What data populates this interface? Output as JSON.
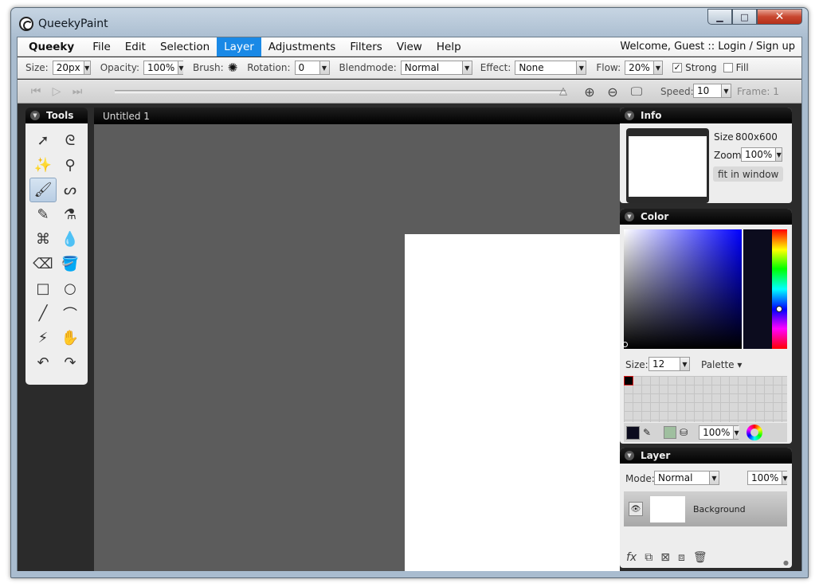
{
  "window": {
    "title": "QueekyPaint",
    "min": "▁",
    "max": "□",
    "close": "✕"
  },
  "menu": {
    "items": [
      "Queeky",
      "File",
      "Edit",
      "Selection",
      "Layer",
      "Adjustments",
      "Filters",
      "View",
      "Help"
    ],
    "active": "Layer",
    "welcome": "Welcome, Guest :: Login  / Sign up"
  },
  "toolbar": {
    "size_label": "Size:",
    "size_value": "20px",
    "opacity_label": "Opacity:",
    "opacity_value": "100%",
    "brush_label": "Brush:",
    "rotation_label": "Rotation:",
    "rotation_value": "0",
    "blend_label": "Blendmode:",
    "blend_value": "Normal",
    "effect_label": "Effect:",
    "effect_value": "None",
    "flow_label": "Flow:",
    "flow_value": "20%",
    "strong_label": "Strong",
    "strong_checked": true,
    "fill_label": "Fill",
    "fill_checked": false
  },
  "animation": {
    "speed_label": "Speed:",
    "speed_value": "10",
    "frame_text": "Frame: 1"
  },
  "tools_panel": {
    "title": "Tools",
    "tools": [
      {
        "icon": "arrow-icon",
        "glyph": "➚",
        "active": false
      },
      {
        "icon": "lasso-icon",
        "glyph": "ᘓ",
        "active": false
      },
      {
        "icon": "magic-wand-icon",
        "glyph": "✨",
        "active": false
      },
      {
        "icon": "magnifier-icon",
        "glyph": "⚲",
        "active": false
      },
      {
        "icon": "brush-icon",
        "glyph": "🖌",
        "active": true
      },
      {
        "icon": "smudge-icon",
        "glyph": "ᔕ",
        "active": false
      },
      {
        "icon": "pencil-icon",
        "glyph": "✎",
        "active": false
      },
      {
        "icon": "spray-can-icon",
        "glyph": "⚗",
        "active": false
      },
      {
        "icon": "web-pattern-icon",
        "glyph": "⌘",
        "active": false
      },
      {
        "icon": "drop-icon",
        "glyph": "💧",
        "active": false
      },
      {
        "icon": "eraser-icon",
        "glyph": "⌫",
        "active": false
      },
      {
        "icon": "paint-bucket-icon",
        "glyph": "🪣",
        "active": false
      },
      {
        "icon": "rectangle-icon",
        "glyph": "□",
        "active": false
      },
      {
        "icon": "ellipse-icon",
        "glyph": "○",
        "active": false
      },
      {
        "icon": "line-icon",
        "glyph": "╱",
        "active": false
      },
      {
        "icon": "curve-icon",
        "glyph": "⌒",
        "active": false
      },
      {
        "icon": "zigzag-icon",
        "glyph": "⚡",
        "active": false
      },
      {
        "icon": "hand-icon",
        "glyph": "✋",
        "active": false
      },
      {
        "icon": "undo-icon",
        "glyph": "↶",
        "active": false
      },
      {
        "icon": "redo-icon",
        "glyph": "↷",
        "active": false
      }
    ]
  },
  "document": {
    "tab_title": "Untitled 1"
  },
  "info_panel": {
    "title": "Info",
    "size_label": "Size",
    "size_value": "800x600",
    "zoom_label": "Zoom",
    "zoom_value": "100%",
    "fit_button": "fit in window"
  },
  "color_panel": {
    "title": "Color",
    "size_label": "Size:",
    "size_value": "12",
    "palette_label": "Palette ▾",
    "opacity_value": "100%",
    "fg_color": "#0c0c1e",
    "bg_color": "#9fbf9f"
  },
  "layer_panel": {
    "title": "Layer",
    "mode_label": "Mode:",
    "mode_value": "Normal",
    "opacity_value": "100%",
    "layers": [
      {
        "name": "Background"
      }
    ]
  }
}
